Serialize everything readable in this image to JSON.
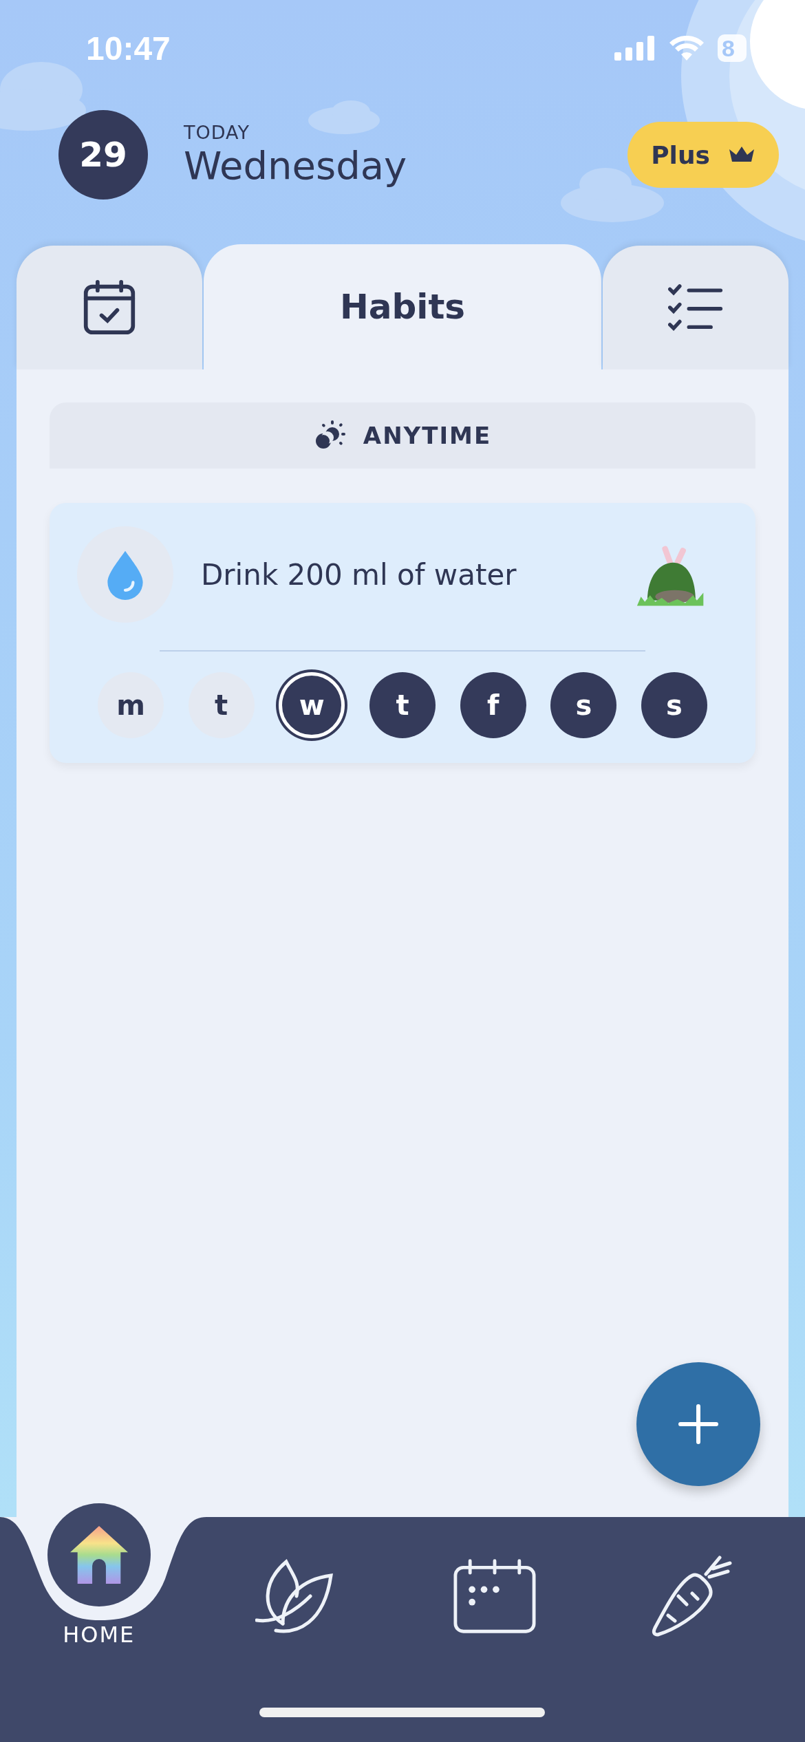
{
  "status_bar": {
    "time": "10:47",
    "battery": "8"
  },
  "header": {
    "date": "29",
    "caption": "TODAY",
    "day": "Wednesday",
    "plus_button": "Plus"
  },
  "tabs": [
    {
      "kind": "calendar",
      "selected": false
    },
    {
      "kind": "text",
      "label": "Habits",
      "selected": true
    },
    {
      "kind": "checklist",
      "selected": false
    }
  ],
  "section": {
    "label": "ANYTIME"
  },
  "habits": [
    {
      "title": "Drink 200 ml of water",
      "days": [
        {
          "label": "m",
          "kind": "past"
        },
        {
          "label": "t",
          "kind": "past"
        },
        {
          "label": "w",
          "kind": "today"
        },
        {
          "label": "t",
          "kind": "future"
        },
        {
          "label": "f",
          "kind": "future"
        },
        {
          "label": "s",
          "kind": "future"
        },
        {
          "label": "s",
          "kind": "future"
        }
      ]
    }
  ],
  "nav": [
    {
      "kind": "home",
      "label": "HOME",
      "selected": true
    },
    {
      "kind": "leaves",
      "selected": false
    },
    {
      "kind": "calendar",
      "selected": false
    },
    {
      "kind": "carrot",
      "selected": false
    }
  ]
}
